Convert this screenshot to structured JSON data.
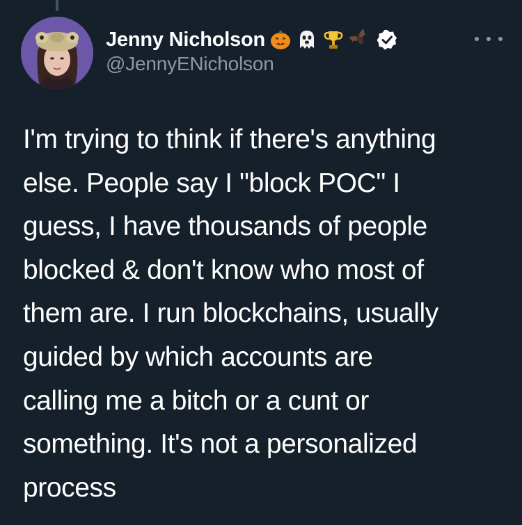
{
  "author": {
    "display_name": "Jenny Nicholson",
    "handle": "@JennyENicholson",
    "verified": true,
    "name_emojis": [
      "jack-o-lantern-icon",
      "ghost-icon",
      "trophy-icon",
      "bat-icon"
    ]
  },
  "tweet": {
    "lines": [
      "I'm trying to think if there's anything",
      "else. People say I \"block POC\" I",
      "guess, I have thousands of people",
      "blocked & don't know who most of",
      "them are. I run blockchains, usually",
      "guided by which accounts are",
      "calling me a bitch or a cunt or",
      "something. It's not a personalized",
      "process"
    ]
  },
  "theme": {
    "background": "#15202b",
    "text": "#ffffff",
    "secondary_text": "#8b98a5",
    "verified_badge": "#ffffff"
  }
}
